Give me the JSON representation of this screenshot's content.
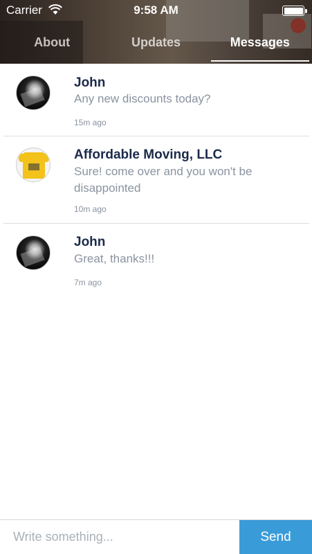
{
  "status_bar": {
    "carrier": "Carrier",
    "time": "9:58 AM",
    "wifi_icon": "wifi-icon",
    "battery_icon": "battery-icon"
  },
  "tabs": [
    {
      "label": "About"
    },
    {
      "label": "Updates"
    },
    {
      "label": "Messages",
      "active": true
    }
  ],
  "messages": [
    {
      "sender": "John",
      "text": "Any new discounts today?",
      "time": "15m ago",
      "avatar": "john-avatar"
    },
    {
      "sender": "Affordable Moving, LLC",
      "text": "Sure! come over and you won't be disappointed",
      "time": "10m ago",
      "avatar": "business-avatar"
    },
    {
      "sender": "John",
      "text": "Great, thanks!!!",
      "time": "7m ago",
      "avatar": "john-avatar"
    }
  ],
  "composer": {
    "placeholder": "Write something...",
    "send_label": "Send"
  },
  "colors": {
    "accent": "#3a9bd9",
    "name_text": "#1b2a4a",
    "secondary_text": "#8a93a0"
  }
}
